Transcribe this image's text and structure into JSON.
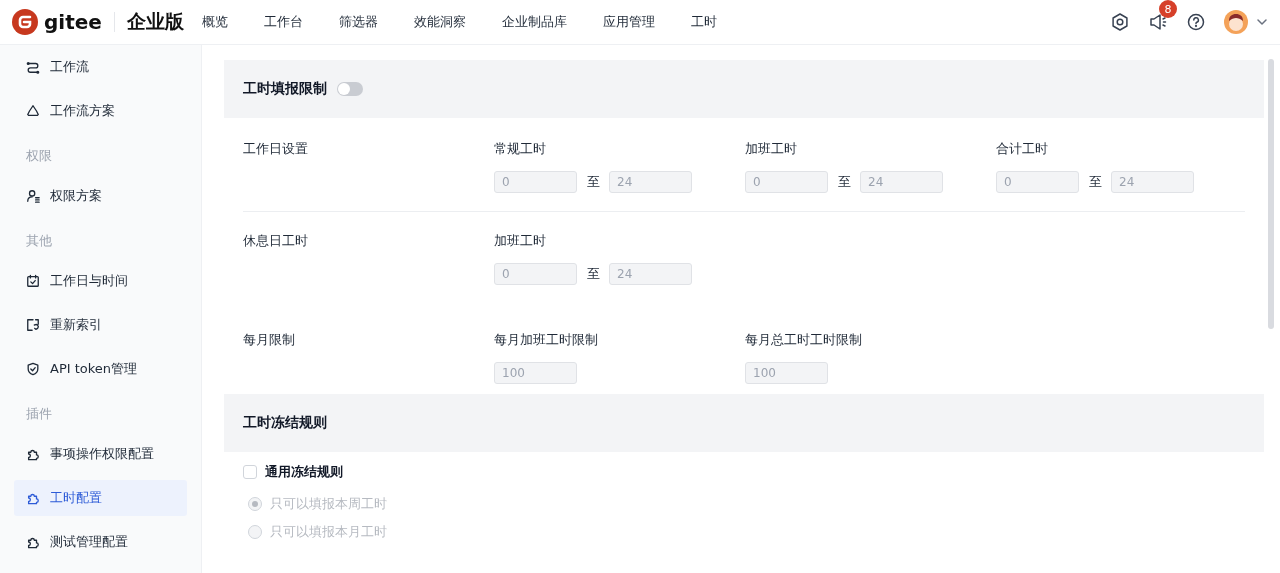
{
  "header": {
    "brand": "gitee",
    "edition": "企业版",
    "nav": [
      "概览",
      "工作台",
      "筛选器",
      "效能洞察",
      "企业制品库",
      "应用管理",
      "工时"
    ],
    "notification_count": "8"
  },
  "sidebar": {
    "entries": [
      {
        "kind": "item",
        "label": "工作流",
        "selected": false
      },
      {
        "kind": "item",
        "label": "工作流方案",
        "selected": false
      },
      {
        "kind": "group",
        "label": "权限"
      },
      {
        "kind": "item",
        "label": "权限方案",
        "selected": false
      },
      {
        "kind": "group",
        "label": "其他"
      },
      {
        "kind": "item",
        "label": "工作日与时间",
        "selected": false
      },
      {
        "kind": "item",
        "label": "重新索引",
        "selected": false
      },
      {
        "kind": "item",
        "label": "API token管理",
        "selected": false
      },
      {
        "kind": "group",
        "label": "插件"
      },
      {
        "kind": "item",
        "label": "事项操作权限配置",
        "selected": false
      },
      {
        "kind": "item",
        "label": "工时配置",
        "selected": true
      },
      {
        "kind": "item",
        "label": "测试管理配置",
        "selected": false
      }
    ]
  },
  "limit_section": {
    "title": "工时填报限制",
    "toggle_on": false,
    "rows": [
      {
        "label": "工作日设置",
        "divider": true,
        "groups": [
          {
            "label": "常规工时",
            "separator": "至",
            "fields": [
              {
                "value": "0",
                "disabled": true
              },
              {
                "value": "24",
                "disabled": true
              }
            ]
          },
          {
            "label": "加班工时",
            "separator": "至",
            "fields": [
              {
                "value": "0",
                "disabled": true
              },
              {
                "value": "24",
                "disabled": true
              }
            ]
          },
          {
            "label": "合计工时",
            "separator": "至",
            "fields": [
              {
                "value": "0",
                "disabled": true
              },
              {
                "value": "24",
                "disabled": true
              }
            ]
          }
        ]
      },
      {
        "label": "休息日工时",
        "groups": [
          {
            "label": "加班工时",
            "separator": "至",
            "fields": [
              {
                "value": "0",
                "disabled": true
              },
              {
                "value": "24",
                "disabled": true
              }
            ]
          }
        ]
      },
      {
        "label": "每月限制",
        "groups": [
          {
            "label": "每月加班工时限制",
            "fields": [
              {
                "value": "100",
                "disabled": true
              }
            ]
          },
          {
            "label": "每月总工时工时限制",
            "fields": [
              {
                "value": "100",
                "disabled": true
              }
            ]
          }
        ]
      }
    ]
  },
  "freeze_section": {
    "title": "工时冻结规则",
    "checkbox": {
      "label": "通用冻结规则",
      "checked": false
    },
    "radios": [
      {
        "label": "只可以填报本周工时",
        "selected": true,
        "disabled": true
      },
      {
        "label": "只可以填报本月工时",
        "selected": false,
        "disabled": true
      }
    ]
  }
}
